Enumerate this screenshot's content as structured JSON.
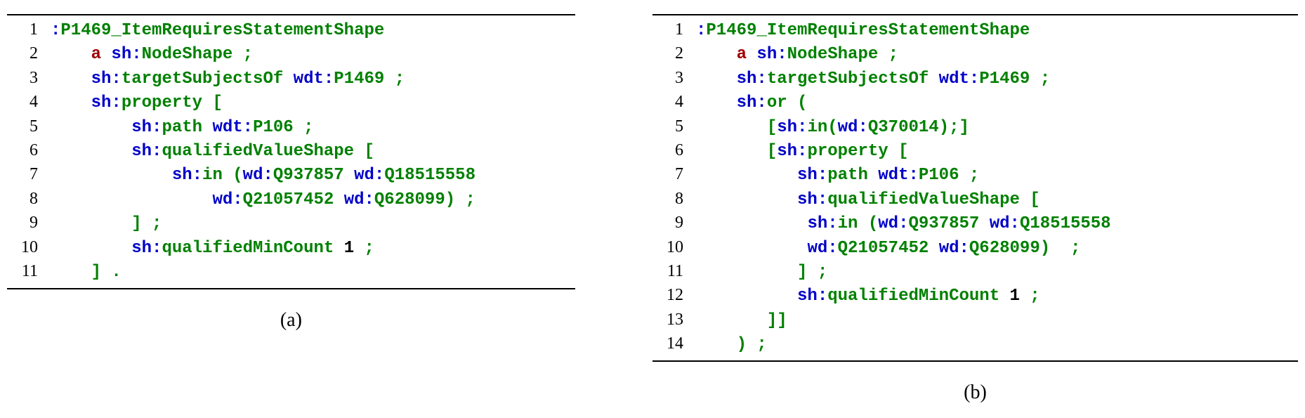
{
  "panels": [
    {
      "id": "a",
      "caption": "(a)",
      "lines": [
        [
          {
            "c": "kw",
            "t": ":"
          },
          {
            "c": "name",
            "t": "P1469_ItemRequiresStatementShape"
          }
        ],
        [
          {
            "c": "pun",
            "t": "    "
          },
          {
            "c": "a",
            "t": "a"
          },
          {
            "c": "pun",
            "t": " "
          },
          {
            "c": "kw",
            "t": "sh:"
          },
          {
            "c": "name",
            "t": "NodeShape"
          },
          {
            "c": "pun",
            "t": " ;"
          }
        ],
        [
          {
            "c": "pun",
            "t": "    "
          },
          {
            "c": "kw",
            "t": "sh:"
          },
          {
            "c": "name",
            "t": "targetSubjectsOf"
          },
          {
            "c": "pun",
            "t": " "
          },
          {
            "c": "kw",
            "t": "wdt:"
          },
          {
            "c": "name",
            "t": "P1469"
          },
          {
            "c": "pun",
            "t": " ;"
          }
        ],
        [
          {
            "c": "pun",
            "t": "    "
          },
          {
            "c": "kw",
            "t": "sh:"
          },
          {
            "c": "name",
            "t": "property"
          },
          {
            "c": "pun",
            "t": " ["
          }
        ],
        [
          {
            "c": "pun",
            "t": "        "
          },
          {
            "c": "kw",
            "t": "sh:"
          },
          {
            "c": "name",
            "t": "path"
          },
          {
            "c": "pun",
            "t": " "
          },
          {
            "c": "kw",
            "t": "wdt:"
          },
          {
            "c": "name",
            "t": "P106"
          },
          {
            "c": "pun",
            "t": " ;"
          }
        ],
        [
          {
            "c": "pun",
            "t": "        "
          },
          {
            "c": "kw",
            "t": "sh:"
          },
          {
            "c": "name",
            "t": "qualifiedValueShape"
          },
          {
            "c": "pun",
            "t": " ["
          }
        ],
        [
          {
            "c": "pun",
            "t": "            "
          },
          {
            "c": "kw",
            "t": "sh:"
          },
          {
            "c": "name",
            "t": "in"
          },
          {
            "c": "pun",
            "t": " ("
          },
          {
            "c": "kw",
            "t": "wd:"
          },
          {
            "c": "name",
            "t": "Q937857"
          },
          {
            "c": "pun",
            "t": " "
          },
          {
            "c": "kw",
            "t": "wd:"
          },
          {
            "c": "name",
            "t": "Q18515558"
          }
        ],
        [
          {
            "c": "pun",
            "t": "                "
          },
          {
            "c": "kw",
            "t": "wd:"
          },
          {
            "c": "name",
            "t": "Q21057452"
          },
          {
            "c": "pun",
            "t": " "
          },
          {
            "c": "kw",
            "t": "wd:"
          },
          {
            "c": "name",
            "t": "Q628099"
          },
          {
            "c": "pun",
            "t": ") ;"
          }
        ],
        [
          {
            "c": "pun",
            "t": "        ] ;"
          }
        ],
        [
          {
            "c": "pun",
            "t": "        "
          },
          {
            "c": "kw",
            "t": "sh:"
          },
          {
            "c": "name",
            "t": "qualifiedMinCount"
          },
          {
            "c": "pun",
            "t": " "
          },
          {
            "c": "num",
            "t": "1"
          },
          {
            "c": "pun",
            "t": " ;"
          }
        ],
        [
          {
            "c": "pun",
            "t": "    ] ."
          }
        ]
      ]
    },
    {
      "id": "b",
      "caption": "(b)",
      "lines": [
        [
          {
            "c": "kw",
            "t": ":"
          },
          {
            "c": "name",
            "t": "P1469_ItemRequiresStatementShape"
          }
        ],
        [
          {
            "c": "pun",
            "t": "    "
          },
          {
            "c": "a",
            "t": "a"
          },
          {
            "c": "pun",
            "t": " "
          },
          {
            "c": "kw",
            "t": "sh:"
          },
          {
            "c": "name",
            "t": "NodeShape"
          },
          {
            "c": "pun",
            "t": " ;"
          }
        ],
        [
          {
            "c": "pun",
            "t": "    "
          },
          {
            "c": "kw",
            "t": "sh:"
          },
          {
            "c": "name",
            "t": "targetSubjectsOf"
          },
          {
            "c": "pun",
            "t": " "
          },
          {
            "c": "kw",
            "t": "wdt:"
          },
          {
            "c": "name",
            "t": "P1469"
          },
          {
            "c": "pun",
            "t": " ;"
          }
        ],
        [
          {
            "c": "pun",
            "t": "    "
          },
          {
            "c": "kw",
            "t": "sh:"
          },
          {
            "c": "name",
            "t": "or"
          },
          {
            "c": "pun",
            "t": " ("
          }
        ],
        [
          {
            "c": "pun",
            "t": "       ["
          },
          {
            "c": "kw",
            "t": "sh:"
          },
          {
            "c": "name",
            "t": "in"
          },
          {
            "c": "pun",
            "t": "("
          },
          {
            "c": "kw",
            "t": "wd:"
          },
          {
            "c": "name",
            "t": "Q370014"
          },
          {
            "c": "pun",
            "t": ");]"
          }
        ],
        [
          {
            "c": "pun",
            "t": "       ["
          },
          {
            "c": "kw",
            "t": "sh:"
          },
          {
            "c": "name",
            "t": "property"
          },
          {
            "c": "pun",
            "t": " ["
          }
        ],
        [
          {
            "c": "pun",
            "t": "          "
          },
          {
            "c": "kw",
            "t": "sh:"
          },
          {
            "c": "name",
            "t": "path"
          },
          {
            "c": "pun",
            "t": " "
          },
          {
            "c": "kw",
            "t": "wdt:"
          },
          {
            "c": "name",
            "t": "P106"
          },
          {
            "c": "pun",
            "t": " ;"
          }
        ],
        [
          {
            "c": "pun",
            "t": "          "
          },
          {
            "c": "kw",
            "t": "sh:"
          },
          {
            "c": "name",
            "t": "qualifiedValueShape"
          },
          {
            "c": "pun",
            "t": " ["
          }
        ],
        [
          {
            "c": "pun",
            "t": "           "
          },
          {
            "c": "kw",
            "t": "sh:"
          },
          {
            "c": "name",
            "t": "in"
          },
          {
            "c": "pun",
            "t": " ("
          },
          {
            "c": "kw",
            "t": "wd:"
          },
          {
            "c": "name",
            "t": "Q937857"
          },
          {
            "c": "pun",
            "t": " "
          },
          {
            "c": "kw",
            "t": "wd:"
          },
          {
            "c": "name",
            "t": "Q18515558"
          }
        ],
        [
          {
            "c": "pun",
            "t": "           "
          },
          {
            "c": "kw",
            "t": "wd:"
          },
          {
            "c": "name",
            "t": "Q21057452"
          },
          {
            "c": "pun",
            "t": " "
          },
          {
            "c": "kw",
            "t": "wd:"
          },
          {
            "c": "name",
            "t": "Q628099"
          },
          {
            "c": "pun",
            "t": ")  ;"
          }
        ],
        [
          {
            "c": "pun",
            "t": "          ] ;"
          }
        ],
        [
          {
            "c": "pun",
            "t": "          "
          },
          {
            "c": "kw",
            "t": "sh:"
          },
          {
            "c": "name",
            "t": "qualifiedMinCount"
          },
          {
            "c": "pun",
            "t": " "
          },
          {
            "c": "num",
            "t": "1"
          },
          {
            "c": "pun",
            "t": " ;"
          }
        ],
        [
          {
            "c": "pun",
            "t": "       ]]"
          }
        ],
        [
          {
            "c": "pun",
            "t": "    ) ;"
          }
        ]
      ]
    }
  ]
}
